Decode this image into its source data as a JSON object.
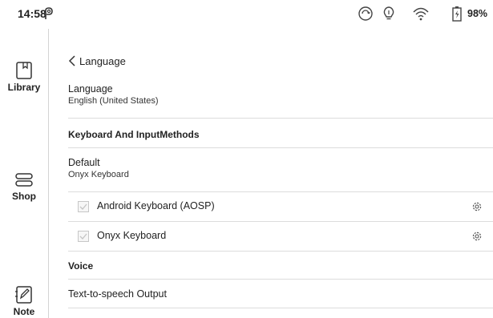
{
  "status_bar": {
    "time": "14:58",
    "battery": "98%",
    "icons": [
      "p-icon",
      "sync-icon",
      "bulb-icon",
      "wifi-icon",
      "battery-icon"
    ]
  },
  "sidebar": {
    "items": [
      {
        "label": "Library",
        "icon": "library-icon"
      },
      {
        "label": "Shop",
        "icon": "shop-icon"
      },
      {
        "label": "Note",
        "icon": "note-icon"
      }
    ]
  },
  "main": {
    "back_label": "Language",
    "language": {
      "title": "Language",
      "value": "English (United States)"
    },
    "keyboard_section": "Keyboard And InputMethods",
    "default_kb": {
      "title": "Default",
      "value": "Onyx Keyboard"
    },
    "keyboards": [
      {
        "label": "Android Keyboard (AOSP)",
        "checked": true
      },
      {
        "label": "Onyx Keyboard",
        "checked": true
      }
    ],
    "voice_section": "Voice",
    "tts": {
      "title": "Text-to-speech Output"
    }
  },
  "colors": {
    "divider": "#dcdcdc",
    "text": "#222222"
  }
}
